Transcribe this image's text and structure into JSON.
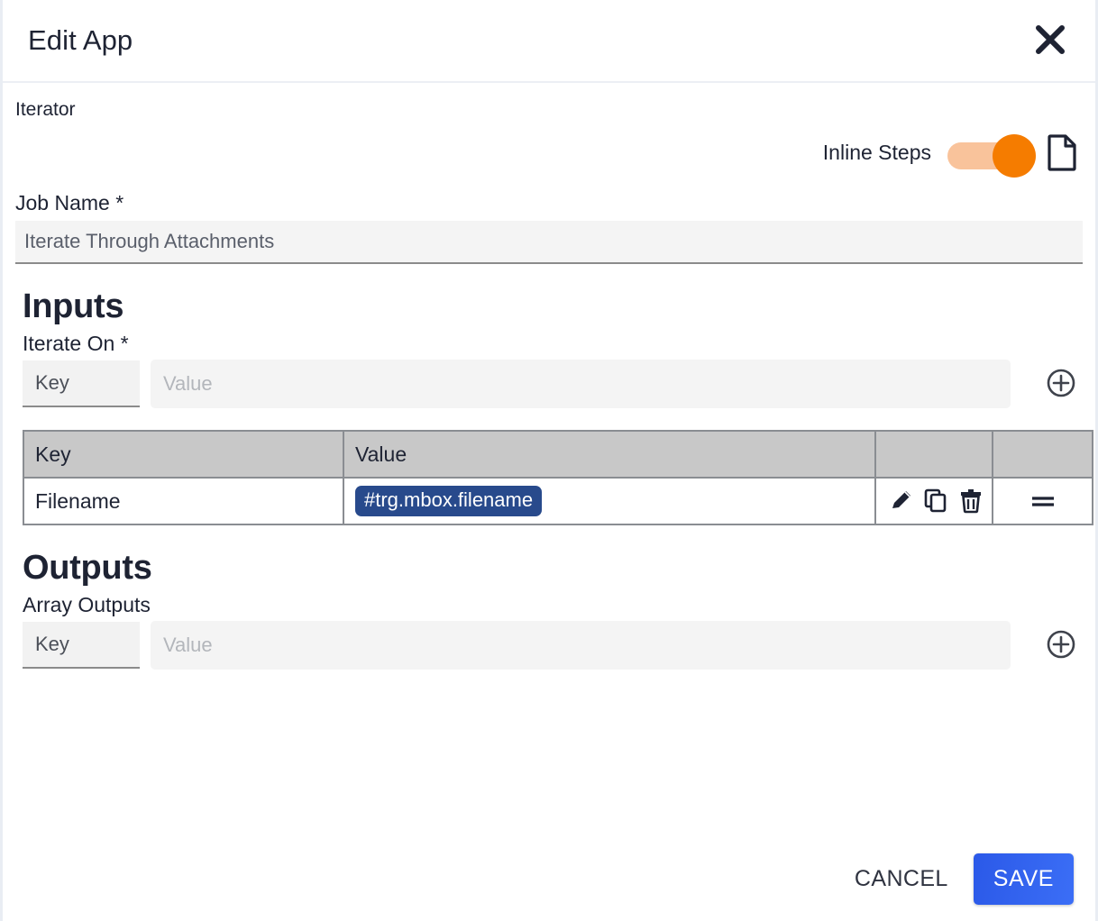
{
  "header": {
    "title": "Edit App",
    "close_icon": "close-icon"
  },
  "subtitle": "Iterator",
  "inline_steps": {
    "label": "Inline Steps",
    "toggle_state": "on",
    "toggle_on_color": "#f57c00",
    "toggle_track_color": "#f9c39b",
    "doc_icon": "document-icon"
  },
  "job_name": {
    "label": "Job Name *",
    "value": "Iterate Through Attachments",
    "placeholder": "Job Name"
  },
  "inputs": {
    "heading": "Inputs",
    "iterate_on": {
      "label": "Iterate On *",
      "key_placeholder": "Key",
      "value_placeholder": "Value",
      "key_value": "",
      "value_value": "",
      "add_icon": "circle-plus-icon"
    },
    "table": {
      "columns": [
        "Key",
        "Value",
        "",
        ""
      ],
      "rows": [
        {
          "key": "Filename",
          "value": "#trg.mbox.filename",
          "value_chip_color": "#284a8c",
          "actions": [
            "edit-icon",
            "copy-icon",
            "delete-icon"
          ],
          "drag": "drag-handle-icon"
        }
      ]
    }
  },
  "outputs": {
    "heading": "Outputs",
    "array_outputs": {
      "label": "Array Outputs",
      "key_placeholder": "Key",
      "value_placeholder": "Value",
      "key_value": "",
      "value_value": "",
      "add_icon": "circle-plus-icon"
    }
  },
  "footer": {
    "cancel_label": "CANCEL",
    "save_label": "SAVE",
    "save_color": "#3b6ef6"
  }
}
